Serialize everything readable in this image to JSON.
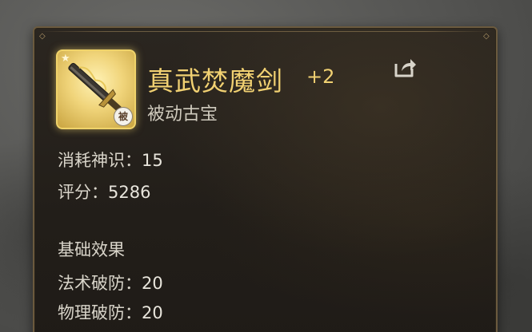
{
  "item": {
    "name": "真武焚魔剑",
    "level": "+2",
    "type": "被动古宝",
    "badge": "被",
    "icon": "sword-icon",
    "frame_color": "#f0d36a",
    "name_color": "#f1d172"
  },
  "stats": {
    "consumption_label": "消耗神识：",
    "consumption_value": "15",
    "score_label": "评分：",
    "score_value": "5286"
  },
  "base_effects": {
    "title": "基础效果",
    "items": [
      {
        "label": "法术破防：",
        "value": "20"
      },
      {
        "label": "物理破防：",
        "value": "20"
      }
    ]
  },
  "actions": {
    "share_icon": "share-icon"
  }
}
